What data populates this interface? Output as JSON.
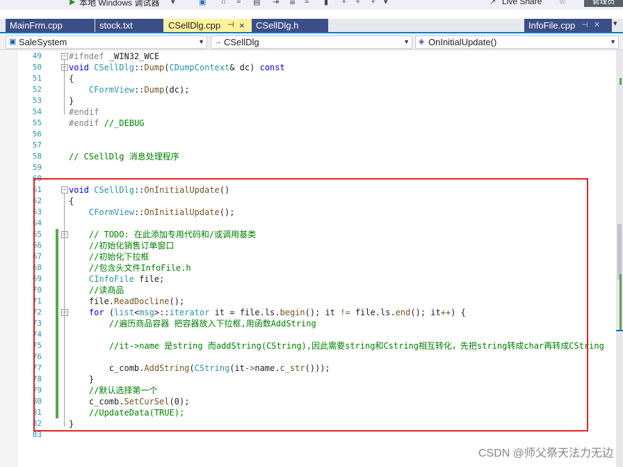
{
  "toolbar": {
    "debugger_label": "本地 Windows 调试器",
    "live_share_label": "Live Share",
    "admin_label": "管理员"
  },
  "tabs": [
    {
      "label": "MainFrm.cpp",
      "active": false
    },
    {
      "label": "stock.txt",
      "active": false
    },
    {
      "label": "CSellDlg.cpp",
      "active": true,
      "pin_glyph": "⊣",
      "close_glyph": "×"
    },
    {
      "label": "CSellDlg.h",
      "active": false
    },
    {
      "label": "InfoFile.cpp",
      "active": false
    }
  ],
  "navbar": {
    "project": "SaleSystem",
    "scope_prefix": "→",
    "scope": "CSellDlg",
    "member": "OnInitialUpdate()"
  },
  "editor": {
    "lines": [
      {
        "n": "49",
        "text": "#ifndef _WIN32_WCE",
        "fold": "−",
        "tokens": [
          [
            "pp",
            "#ifndef"
          ],
          [
            "pu",
            " _WIN32_WCE"
          ]
        ]
      },
      {
        "n": "50",
        "text": "void CSellDlg::Dump(CDumpContext& dc) const",
        "fold": "−",
        "tokens": [
          [
            "kw",
            "void"
          ],
          [
            "pu",
            " "
          ],
          [
            "ty",
            "CSellDlg"
          ],
          [
            "pu",
            "::"
          ],
          [
            "fn",
            "Dump"
          ],
          [
            "pu",
            "("
          ],
          [
            "ty",
            "CDumpContext"
          ],
          [
            "pu",
            "& dc) "
          ],
          [
            "kw",
            "const"
          ]
        ]
      },
      {
        "n": "51",
        "text": "{",
        "tokens": [
          [
            "pu",
            "{"
          ]
        ]
      },
      {
        "n": "52",
        "text": "    CFormView::Dump(dc);",
        "tokens": [
          [
            "pu",
            "    "
          ],
          [
            "ty",
            "CFormView"
          ],
          [
            "pu",
            "::"
          ],
          [
            "fn",
            "Dump"
          ],
          [
            "pu",
            "(dc);"
          ]
        ]
      },
      {
        "n": "53",
        "text": "}",
        "tokens": [
          [
            "pu",
            "}"
          ]
        ]
      },
      {
        "n": "54",
        "text": "#endif",
        "tokens": [
          [
            "pp",
            "#endif"
          ]
        ]
      },
      {
        "n": "55",
        "text": "#endif //_DEBUG",
        "tokens": [
          [
            "pp",
            "#endif"
          ],
          [
            "pu",
            " "
          ],
          [
            "cm",
            "//_DEBUG"
          ]
        ]
      },
      {
        "n": "56",
        "text": "",
        "tokens": []
      },
      {
        "n": "57",
        "text": "",
        "tokens": []
      },
      {
        "n": "58",
        "text": "// CSellDlg 消息处理程序",
        "tokens": [
          [
            "cm",
            "// CSellDlg 消息处理程序"
          ]
        ]
      },
      {
        "n": "59",
        "text": "",
        "tokens": []
      },
      {
        "n": "60",
        "text": "",
        "tokens": []
      },
      {
        "n": "61",
        "text": "void CSellDlg::OnInitialUpdate()",
        "fold": "−",
        "tokens": [
          [
            "kw",
            "void"
          ],
          [
            "pu",
            " "
          ],
          [
            "ty",
            "CSellDlg"
          ],
          [
            "pu",
            "::"
          ],
          [
            "fn",
            "OnInitialUpdate"
          ],
          [
            "pu",
            "()"
          ]
        ]
      },
      {
        "n": "62",
        "text": "{",
        "tokens": [
          [
            "pu",
            "{"
          ]
        ]
      },
      {
        "n": "63",
        "text": "    CFormView::OnInitialUpdate();",
        "tokens": [
          [
            "pu",
            "    "
          ],
          [
            "ty",
            "CFormView"
          ],
          [
            "pu",
            "::"
          ],
          [
            "fn",
            "OnInitialUpdate"
          ],
          [
            "pu",
            "();"
          ]
        ]
      },
      {
        "n": "64",
        "text": "",
        "tokens": []
      },
      {
        "n": "65",
        "text": "    // TODO: 在此添加专用代码和/或调用基类",
        "fold": "−",
        "changed": true,
        "tokens": [
          [
            "pu",
            "    "
          ],
          [
            "cm",
            "// TODO: 在此添加专用代码和/或调用基类"
          ]
        ]
      },
      {
        "n": "66",
        "text": "    //初始化销售订单窗口",
        "changed": true,
        "tokens": [
          [
            "pu",
            "    "
          ],
          [
            "cm",
            "//初始化销售订单窗口"
          ]
        ]
      },
      {
        "n": "67",
        "text": "    //初始化下拉框",
        "changed": true,
        "tokens": [
          [
            "pu",
            "    "
          ],
          [
            "cm",
            "//初始化下拉框"
          ]
        ]
      },
      {
        "n": "68",
        "text": "    //包含头文件InfoFile.h",
        "changed": true,
        "tokens": [
          [
            "pu",
            "    "
          ],
          [
            "cm",
            "//包含头文件InfoFile.h"
          ]
        ]
      },
      {
        "n": "69",
        "text": "    CInfoFile file;",
        "changed": true,
        "tokens": [
          [
            "pu",
            "    "
          ],
          [
            "ty",
            "CInfoFile"
          ],
          [
            "pu",
            " file;"
          ]
        ]
      },
      {
        "n": "70",
        "text": "    //读商品",
        "changed": true,
        "tokens": [
          [
            "pu",
            "    "
          ],
          [
            "cm",
            "//读商品"
          ]
        ]
      },
      {
        "n": "71",
        "text": "    file.ReadDocline();",
        "changed": true,
        "tokens": [
          [
            "pu",
            "    file."
          ],
          [
            "fn",
            "ReadDocline"
          ],
          [
            "pu",
            "();"
          ]
        ]
      },
      {
        "n": "72",
        "text": "    for (list<msg>::iterator it = file.ls.begin(); it != file.ls.end(); it++) {",
        "fold": "−",
        "changed": true,
        "tokens": [
          [
            "pu",
            "    "
          ],
          [
            "kw",
            "for"
          ],
          [
            "pu",
            " ("
          ],
          [
            "ty",
            "list"
          ],
          [
            "pu",
            "<"
          ],
          [
            "ty",
            "msg"
          ],
          [
            "pu",
            ">::"
          ],
          [
            "ty",
            "iterator"
          ],
          [
            "pu",
            " it = file.ls."
          ],
          [
            "fn",
            "begin"
          ],
          [
            "pu",
            "(); it "
          ],
          [
            "fn",
            "!="
          ],
          [
            "pu",
            " file.ls."
          ],
          [
            "fn",
            "end"
          ],
          [
            "pu",
            "(); it"
          ],
          [
            "fn",
            "++"
          ],
          [
            "pu",
            ") {"
          ]
        ]
      },
      {
        "n": "73",
        "text": "        //遍历商品容器 把容器放入下拉框,用函数AddString",
        "changed": true,
        "tokens": [
          [
            "pu",
            "        "
          ],
          [
            "cm",
            "//遍历商品容器 把容器放入下拉框,用函数AddString"
          ]
        ]
      },
      {
        "n": "74",
        "text": "",
        "changed": true,
        "tokens": []
      },
      {
        "n": "75",
        "text": "        //it->name 是string 而addString(CString),因此需要string和Cstring相互转化，先把string转成char再转成CString",
        "changed": true,
        "tokens": [
          [
            "pu",
            "        "
          ],
          [
            "cm",
            "//it->name 是string 而addString(CString),因此需要string和Cstring相互转化，先把string转成char再转成CString"
          ]
        ]
      },
      {
        "n": "76",
        "text": "",
        "changed": true,
        "tokens": []
      },
      {
        "n": "77",
        "text": "        c_comb.AddString(CString(it->name.c_str()));",
        "changed": true,
        "tokens": [
          [
            "pu",
            "        c_comb."
          ],
          [
            "fn",
            "AddString"
          ],
          [
            "pu",
            "("
          ],
          [
            "ty",
            "CString"
          ],
          [
            "pu",
            "(it"
          ],
          [
            "fn",
            "->"
          ],
          [
            "pu",
            "name."
          ],
          [
            "fn",
            "c_str"
          ],
          [
            "pu",
            "()));"
          ]
        ]
      },
      {
        "n": "78",
        "text": "    }",
        "changed": true,
        "tokens": [
          [
            "pu",
            "    }"
          ]
        ]
      },
      {
        "n": "79",
        "text": "    //默认选择第一个",
        "changed": true,
        "tokens": [
          [
            "pu",
            "    "
          ],
          [
            "cm",
            "//默认选择第一个"
          ]
        ]
      },
      {
        "n": "80",
        "text": "    c_comb.SetCurSel(0);",
        "changed": true,
        "tokens": [
          [
            "pu",
            "    c_comb."
          ],
          [
            "fn",
            "SetCurSel"
          ],
          [
            "pu",
            "(0);"
          ]
        ]
      },
      {
        "n": "81",
        "text": "    //UpdateData(TRUE);",
        "changed": true,
        "tokens": [
          [
            "pu",
            "    "
          ],
          [
            "cm",
            "//UpdateData(TRUE);"
          ]
        ]
      },
      {
        "n": "82",
        "text": "}",
        "tokens": [
          [
            "pu",
            "}"
          ]
        ]
      },
      {
        "n": "83",
        "text": "",
        "tokens": []
      }
    ]
  },
  "watermark": "CSDN @师父祭天法力无边",
  "colors": {
    "annotation_box": "#e02020",
    "tab_active": "#fff29d",
    "tab_inactive": "#3b4f86",
    "accent": "#007acc",
    "change_marker": "#57a64a"
  }
}
